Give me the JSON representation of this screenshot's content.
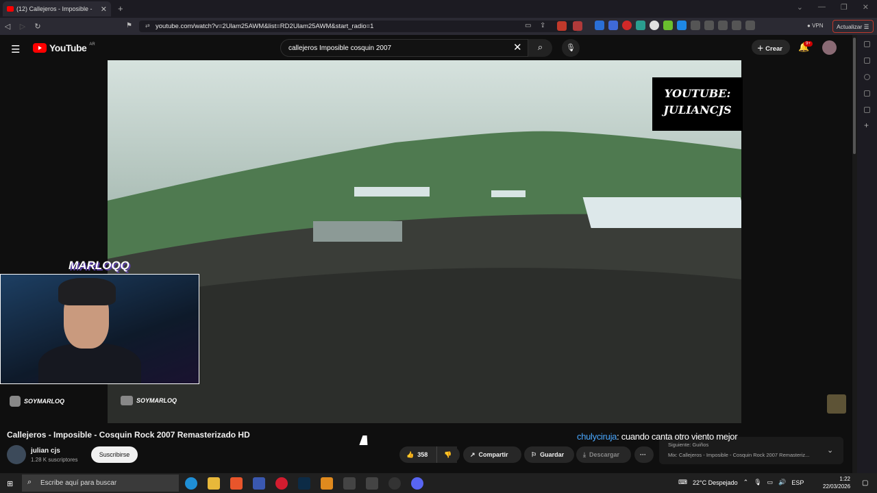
{
  "browser": {
    "tab_title": "(12) Callejeros - Imposible -",
    "tab_close": "✕",
    "new_tab": "+",
    "url": "youtube.com/watch?v=2Ulam25AWM&list=RD2Ulam25AWM&start_radio=1",
    "vpn": "VPN",
    "update_label": "Actualizar"
  },
  "youtube": {
    "logo_text": "YouTube",
    "country": "AR",
    "search_value": "callejeros Imposible cosquin 2007",
    "create_label": "Crear",
    "notification_count": "9+"
  },
  "video": {
    "watermark": "YOUTUBE: JULIANCJS",
    "title": "Callejeros - Imposible - Cosquin Rock 2007 Remasterizado HD",
    "channel_name": "julian cjs",
    "subscribers": "1.28 K suscriptores",
    "subscribe_label": "Suscribirse",
    "likes": "358",
    "share_label": "Compartir",
    "save_label": "Guardar",
    "download_label": "Descargar",
    "more": "···"
  },
  "overlay": {
    "streamer_name": "MARLOQQ",
    "instagram_handle": "SOYMARLOQ",
    "youtube_handle": "SOYMARLOQ",
    "chat_user": "chulyciruja",
    "chat_message": ": cuando canta otro viento mejor"
  },
  "mix": {
    "next_label": "Siguiente: Guiños",
    "title": "Mix: Callejeros - Imposible - Cosquin Rock 2007 Remasteriz..."
  },
  "taskbar": {
    "search_placeholder": "Escribe aquí para buscar",
    "weather": "22°C  Despejado",
    "language": "ESP",
    "time": "1:22",
    "date": "22/03/2026"
  },
  "colors": {
    "youtube_red": "#ff0000",
    "chat_user": "#4aa8ff",
    "update_border": "#c0392b"
  }
}
